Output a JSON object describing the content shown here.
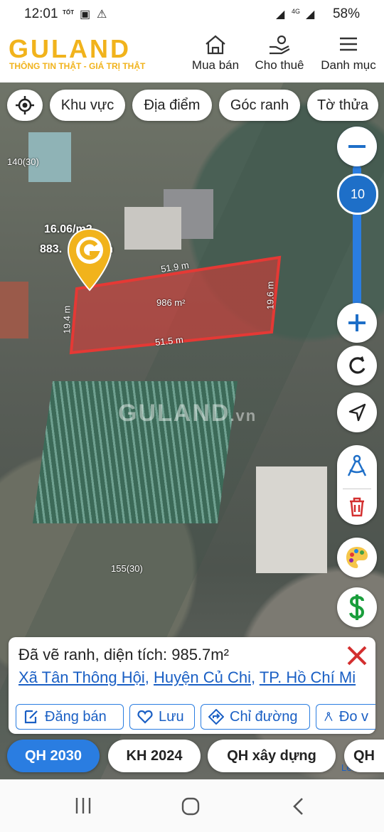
{
  "status": {
    "time": "12:01",
    "carrier_badge": "TỐT",
    "network": "4G",
    "battery": "58%"
  },
  "header": {
    "logo": "GULAND",
    "tagline": "THÔNG TIN THẬT - GIÁ TRỊ THẬT",
    "nav": [
      {
        "label": "Mua bán",
        "icon": "house-icon"
      },
      {
        "label": "Cho thuê",
        "icon": "rent-icon"
      },
      {
        "label": "Danh mục",
        "icon": "menu-icon"
      }
    ]
  },
  "filters": [
    "Khu vực",
    "Địa điểm",
    "Góc ranh",
    "Tờ thửa"
  ],
  "zoom": {
    "level": "10",
    "minus": "−",
    "plus": "+"
  },
  "map": {
    "watermark": "GULAND",
    "watermark_suffix": ".vn",
    "marker_price": "16.06",
    "marker_price_unit": "/m2",
    "marker_total": "883.",
    "marker_total_suffix": "n",
    "parcel_area": "986 m²",
    "edges": {
      "top": "51.9 m",
      "bottom": "51.5 m",
      "left": "19.4 m",
      "right": "19.6 m"
    },
    "plot_labels": [
      "140(30)",
      "155(30)"
    ],
    "attribution": "Leaflet",
    "parcel_color": "#e53935"
  },
  "info": {
    "title": "Đã vẽ ranh, diện tích: 985.7m²",
    "ward": "Xã Tân Thông Hội",
    "district": "Huyện Củ Chi",
    "city": "TP. Hồ Chí Mi",
    "sep": ",",
    "actions": [
      "Đăng bán",
      "Lưu",
      "Chỉ đường",
      "Đo v"
    ]
  },
  "plans": [
    "QH 2030",
    "KH 2024",
    "QH xây dựng",
    "QH"
  ],
  "colors": {
    "brand": "#f1b31c",
    "link": "#1a5fc4",
    "active_plan": "#2a7de1"
  }
}
